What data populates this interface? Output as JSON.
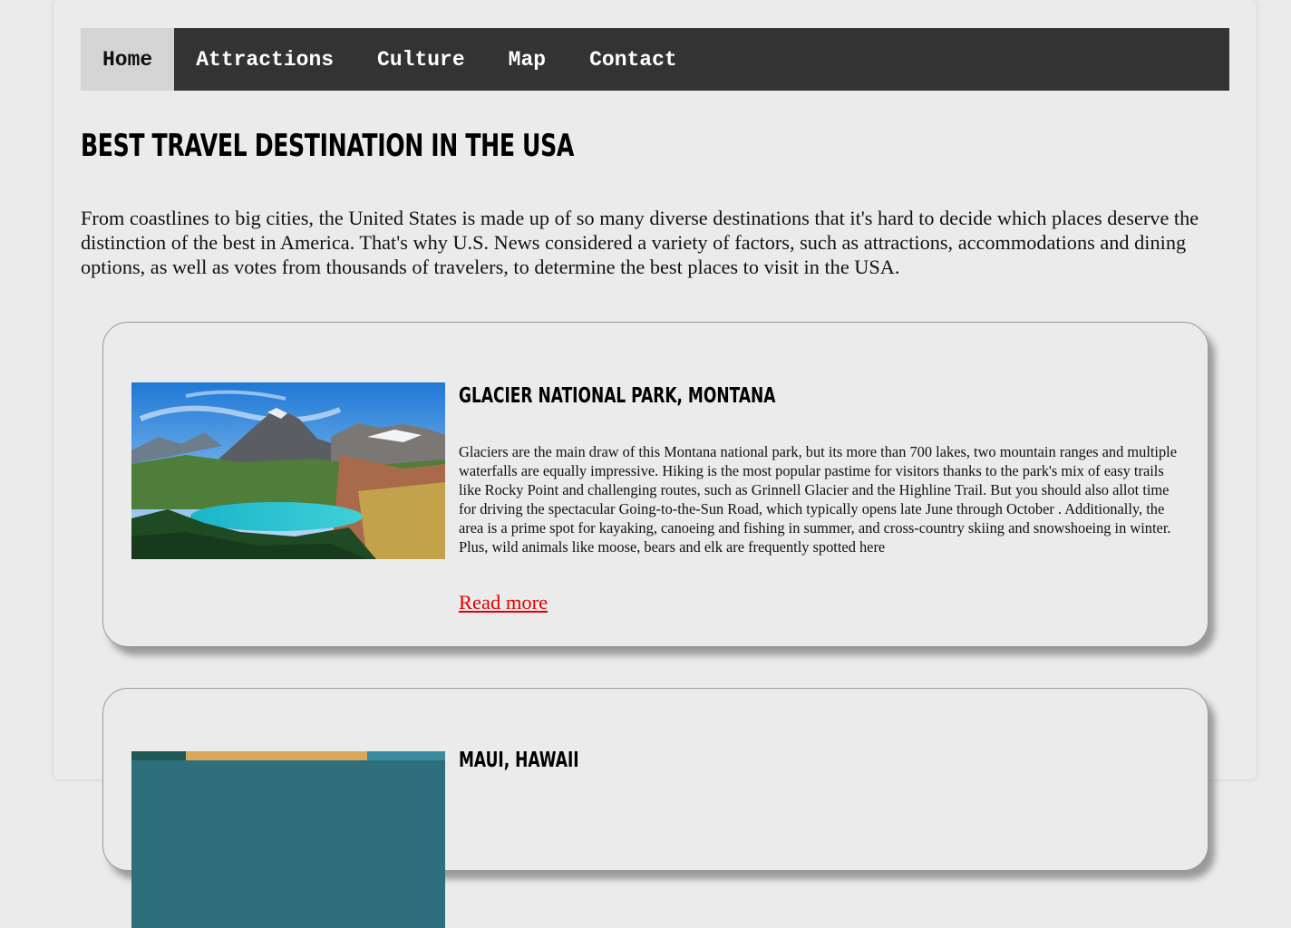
{
  "nav": {
    "items": [
      {
        "label": "Home",
        "active": true
      },
      {
        "label": "Attractions",
        "active": false
      },
      {
        "label": "Culture",
        "active": false
      },
      {
        "label": "Map",
        "active": false
      },
      {
        "label": "Contact",
        "active": false
      }
    ]
  },
  "header": {
    "title": "Best Travel Destination in the USA"
  },
  "intro": "From coastlines to big cities, the United States is made up of so many diverse destinations that it's hard to decide which places deserve the distinction of the best in America. That's why U.S. News considered a variety of factors, such as attractions, accommodations and dining options, as well as votes from thousands of travelers, to determine the best places to visit in the USA.",
  "destinations": [
    {
      "title": "Glacier National Park, Montana",
      "description": "Glaciers are the main draw of this Montana national park, but its more than 700 lakes, two mountain ranges and multiple waterfalls are equally impressive. Hiking is the most popular pastime for visitors thanks to the park's mix of easy trails like Rocky Point and challenging routes, such as Grinnell Glacier and the Highline Trail. But you should also allot time for driving the spectacular Going-to-the-Sun Road, which typically opens late June through October . Additionally, the area is a prime spot for kayaking, canoeing and fishing in summer, and cross-country skiing and snowshoeing in winter. Plus, wild animals like moose, bears and elk are frequently spotted here",
      "link_label": "Read more"
    },
    {
      "title": "Maui, Hawaii"
    }
  ],
  "colors": {
    "nav_background": "#333333",
    "nav_active_background": "#d4d4d4",
    "page_background": "#ebebeb",
    "link": "#e00000"
  }
}
